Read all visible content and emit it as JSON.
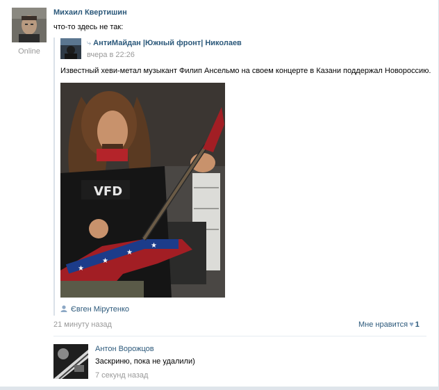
{
  "post": {
    "author": "Михаил Квертишин",
    "online": "Online",
    "text": "что-то здесь не так:",
    "time": "21 минуту назад",
    "like_label": "Мне нравится",
    "like_count": "1"
  },
  "repost": {
    "source_name": "АнтиМайдан |Южный фронт| Николаев",
    "source_time": "вчера в 22:26",
    "text": "Известный хеви-метал музыкант Филип Ансельмо на своем концерте в Казани поддержал Новороссию.",
    "signer": "Євген Мірутенко"
  },
  "comment": {
    "author": "Антон Ворожцов",
    "text": "Заскриню, пока не удалили)",
    "time": "7 секунд назад"
  },
  "colors": {
    "link": "#2b587a",
    "muted": "#999999",
    "divider": "#dae1e8"
  }
}
